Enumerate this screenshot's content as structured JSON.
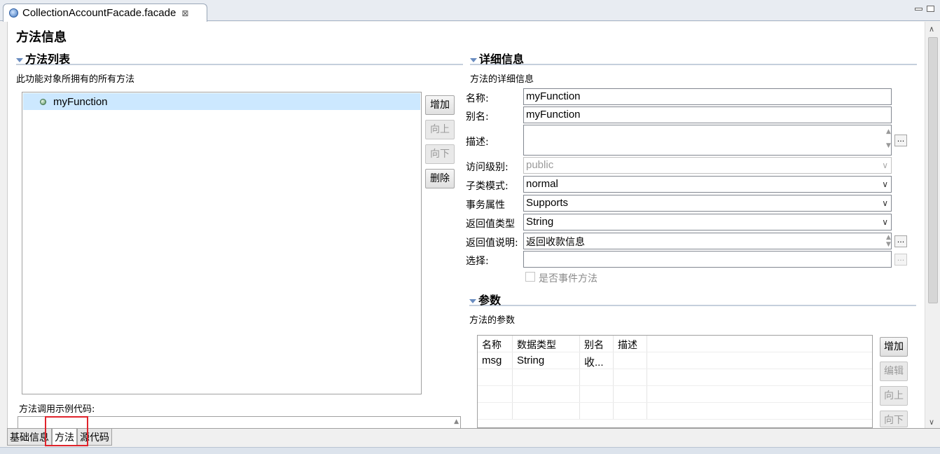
{
  "editor": {
    "tab_title": "CollectionAccountFacade.facade",
    "close_glyph": "⊠"
  },
  "page": {
    "title": "方法信息"
  },
  "methods_section": {
    "title": "方法列表",
    "description": "此功能对象所拥有的所有方法",
    "items": [
      {
        "name": "myFunction",
        "selected": true
      }
    ],
    "buttons": {
      "add": "增加",
      "up": "向上",
      "down": "向下",
      "delete": "删除"
    },
    "example_code_label": "方法调用示例代码:"
  },
  "detail_section": {
    "title": "详细信息",
    "description": "方法的详细信息",
    "name_label": "名称:",
    "name_value": "myFunction",
    "alias_label": "别名:",
    "alias_value": "myFunction",
    "description_label": "描述:",
    "description_value": "",
    "access_label": "访问级别:",
    "access_value": "public",
    "subclass_label": "子类模式:",
    "subclass_value": "normal",
    "transaction_label": "事务属性",
    "transaction_value": "Supports",
    "return_type_label": "返回值类型",
    "return_type_value": "String",
    "return_desc_label": "返回值说明:",
    "return_desc_value": "返回收款信息",
    "select_label": "选择:",
    "select_value": "",
    "event_method_label": "是否事件方法",
    "event_method_checked": false,
    "ellipsis": "..."
  },
  "params_section": {
    "title": "参数",
    "description": "方法的参数",
    "columns": [
      "名称",
      "数据类型",
      "别名",
      "描述"
    ],
    "rows": [
      [
        "msg",
        "String",
        "收...",
        ""
      ]
    ],
    "buttons": {
      "add": "增加",
      "edit": "编辑",
      "up": "向上",
      "down": "向下"
    }
  },
  "bottom_tabs": [
    {
      "label": "基础信息",
      "active": false
    },
    {
      "label": "方法",
      "active": true
    },
    {
      "label": "源代码",
      "active": false
    }
  ],
  "colors": {
    "selection": "#cce8ff",
    "highlight_box": "#e0242c",
    "section_rule": "#c5cfdc"
  }
}
